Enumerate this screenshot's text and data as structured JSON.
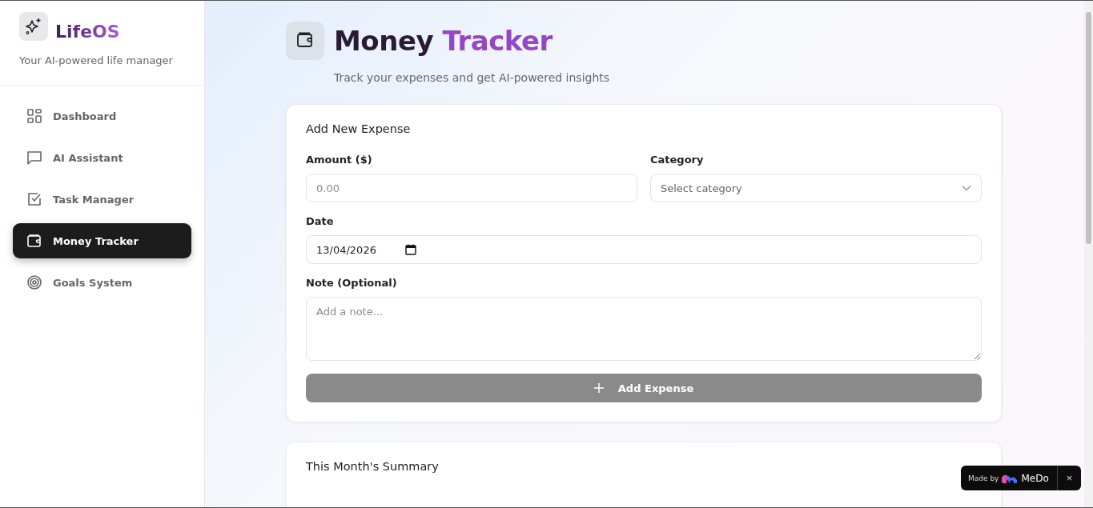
{
  "sidebar": {
    "brand": "LifeOS",
    "tagline": "Your AI-powered life manager",
    "items": [
      {
        "label": "Dashboard",
        "kind": "grid",
        "selected": false
      },
      {
        "label": "AI Assistant",
        "kind": "chat",
        "selected": false
      },
      {
        "label": "Task Manager",
        "kind": "check",
        "selected": false
      },
      {
        "label": "Money Tracker",
        "kind": "wallet",
        "selected": true
      },
      {
        "label": "Goals System",
        "kind": "target",
        "selected": false
      }
    ]
  },
  "header": {
    "title_first": "Money",
    "title_second": "Tracker",
    "subtitle": "Track your expenses and get AI-powered insights"
  },
  "form": {
    "title": "Add New Expense",
    "amount_label": "Amount ($)",
    "amount_placeholder": "0.00",
    "category_label": "Category",
    "category_placeholder": "Select category",
    "date_label": "Date",
    "date_value": "13/04/2026",
    "note_label": "Note (Optional)",
    "note_placeholder": "Add a note...",
    "submit": "Add Expense",
    "submit_disabled": true
  },
  "summary": {
    "title": "This Month's Summary"
  },
  "badge": {
    "made_by": "Made by",
    "brand": "MeDo",
    "close": "×"
  }
}
